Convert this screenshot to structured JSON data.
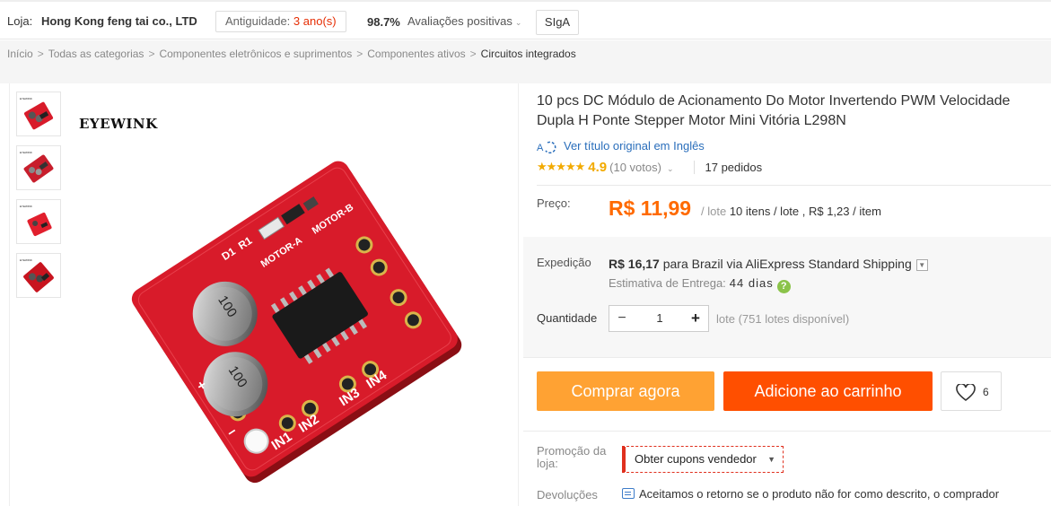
{
  "store_bar": {
    "label": "Loja:",
    "store_name": "Hong Kong feng tai co., LTD",
    "age_label": "Antiguidade:",
    "age_value": "3 ano(s)",
    "positive_pct": "98.7%",
    "positive_label": "Avaliações positivas",
    "follow_label": "SIgA"
  },
  "breadcrumb": {
    "items": [
      "Início",
      "Todas as categorias",
      "Componentes eletrônicos e suprimentos",
      "Componentes ativos"
    ],
    "current": "Circuitos integrados",
    "separator": ">"
  },
  "gallery": {
    "brand_text": "EYEWINK",
    "thumb_count": 4,
    "board_labels": {
      "cap_text": "100 16V RVT",
      "pin_labels": [
        "IN1",
        "IN2",
        "IN3",
        "IN4"
      ],
      "motor_labels": [
        "MOTOR-A",
        "MOTOR-B"
      ],
      "top_labels": [
        "D1",
        "R1"
      ]
    }
  },
  "product": {
    "title": "10 pcs DC Módulo de Acionamento Do Motor Invertendo PWM Velocidade Dupla H Ponte Stepper Motor Mini Vitória L298N",
    "original_title_link": "Ver título original em Inglês",
    "rating_stars": "★★★★★",
    "rating_score": "4.9",
    "rating_votes": "(10 votos)",
    "orders": "17 pedidos"
  },
  "price": {
    "label": "Preço:",
    "value": "R$ 11,99",
    "unit_prefix": "/ lote",
    "unit_detail": "10 itens / lote , R$ 1,23 / item"
  },
  "shipping": {
    "label": "Expedição",
    "cost": "R$ 16,17",
    "text": "para Brazil via AliExpress Standard Shipping",
    "eta_label": "Estimativa de Entrega:",
    "eta_days": "44 dias"
  },
  "quantity": {
    "label": "Quantidade",
    "value": "1",
    "stock": "lote (751 lotes disponível)"
  },
  "actions": {
    "buy_now": "Comprar agora",
    "add_to_cart": "Adicione ao carrinho",
    "wishlist_count": "6"
  },
  "promo": {
    "label": "Promoção da loja:",
    "coupon": "Obter cupons vendedor"
  },
  "returns": {
    "label": "Devoluções",
    "text": "Aceitamos o retorno se o produto não for como descrito, o comprador"
  },
  "colors": {
    "accent_orange": "#ff6a00",
    "buy_button": "#ffa233",
    "cart_button": "#ff4f00",
    "link_blue": "#2a6ebb",
    "board_red": "#d81b2a"
  },
  "icons": [
    "translate-icon",
    "star-icon",
    "chevron-down-icon",
    "help-icon",
    "heart-icon",
    "return-icon",
    "caret-down-icon"
  ]
}
